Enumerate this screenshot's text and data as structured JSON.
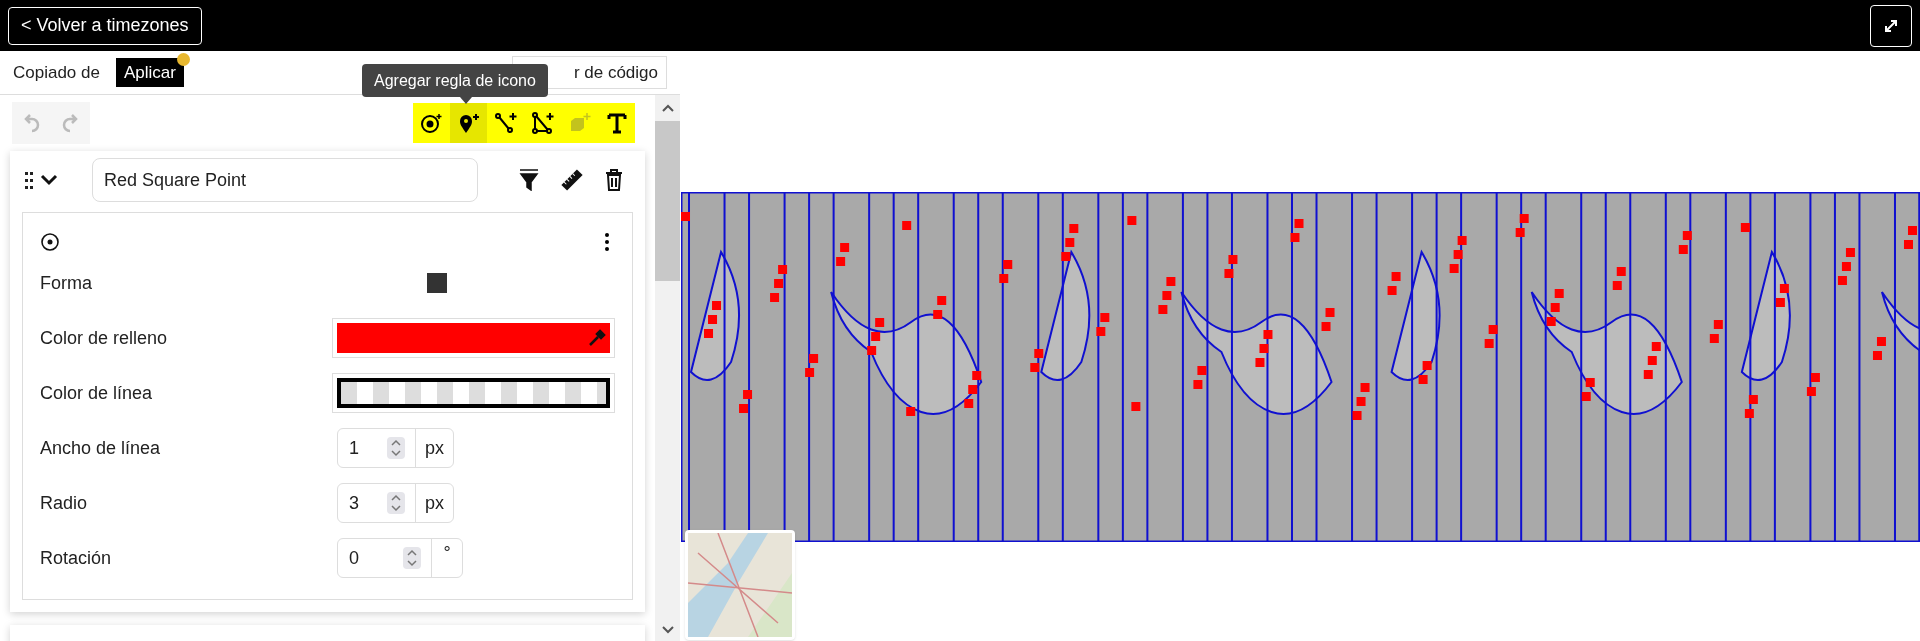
{
  "header": {
    "back_button": "< Volver a timezones"
  },
  "top_bar": {
    "copied_from": "Copiado de",
    "apply_button": {
      "label": "Aplicar",
      "has_changes": true
    },
    "code_editor_button": "r de código"
  },
  "tooltip": "Agregar regla de icono",
  "history": [
    {
      "kind": "undo",
      "disabled": true
    },
    {
      "kind": "redo",
      "disabled": true
    }
  ],
  "add_tools": [
    {
      "kind": "point",
      "selected": false,
      "disabled": false
    },
    {
      "kind": "icon",
      "selected": true,
      "disabled": false
    },
    {
      "kind": "line",
      "selected": false,
      "disabled": false
    },
    {
      "kind": "polygon",
      "selected": false,
      "disabled": false
    },
    {
      "kind": "extrusion",
      "selected": false,
      "disabled": true
    },
    {
      "kind": "text",
      "selected": false,
      "disabled": false
    }
  ],
  "rule": {
    "name": "Red Square Point",
    "expanded": true,
    "fields": [
      {
        "kind": "shape",
        "label": "Forma"
      },
      {
        "kind": "color",
        "label": "Color de relleno",
        "color": "#ff0000"
      },
      {
        "kind": "color",
        "label": "Color de línea",
        "transparent": true
      },
      {
        "kind": "number",
        "label": "Ancho de línea",
        "value": "1",
        "unit": "px"
      },
      {
        "kind": "number",
        "label": "Radio",
        "value": "3",
        "unit": "px"
      },
      {
        "kind": "number",
        "label": "Rotación",
        "value": "0",
        "unit": "°"
      }
    ]
  }
}
